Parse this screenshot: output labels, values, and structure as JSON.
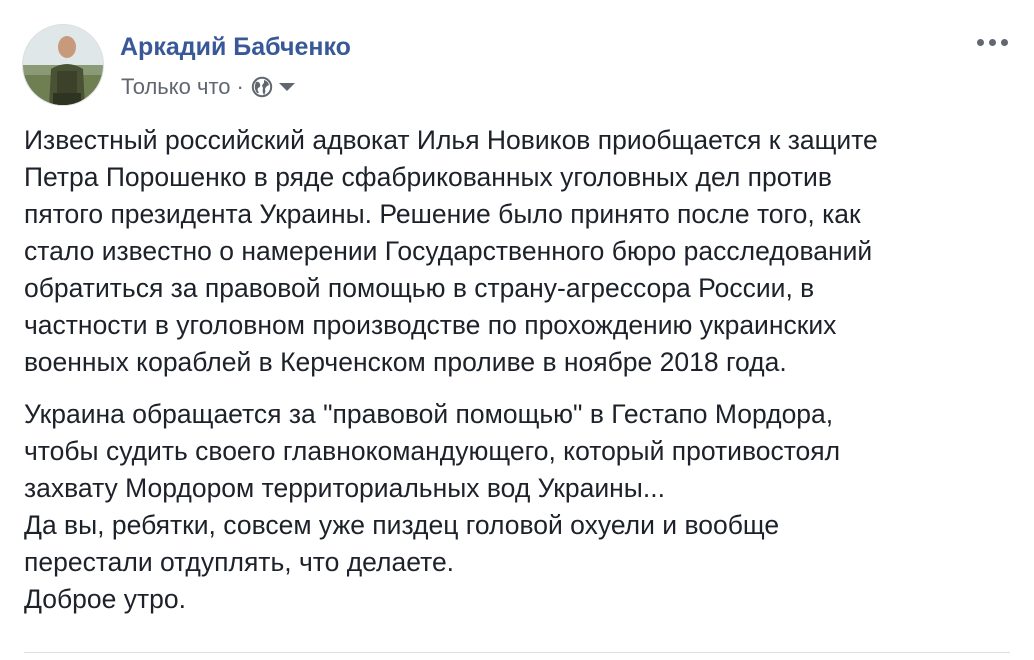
{
  "post": {
    "author_name": "Аркадий Бабченко",
    "timestamp": "Только что",
    "separator": "·",
    "privacy_icon": "globe-icon",
    "audience_menu_icon": "caret-down-icon",
    "more_icon": "more-options-icon",
    "paragraphs": [
      "Известный российский адвокат Илья Новиков приобщается к защите\nПетра Порошенко в ряде сфабрикованных уголовных дел против\nпятого президента Украины. Решение было принято после того, как\nстало известно о намерении Государственного бюро расследований\nобратиться за правовой помощью в страну-агрессора России, в\nчастности в уголовном производстве по прохождению украинских\nвоенных кораблей в Керченском проливе в ноябре 2018 года.",
      "Украина обращается за \"правовой помощью\" в Гестапо Мордора,\nчтобы судить своего главнокомандующего, который противостоял\nзахвату Мордором территориальных вод Украины...\nДа вы, ребятки, совсем уже пиздец головой охуели и вообще\nперестали отдуплять, что делаете.\nДоброе утро."
    ]
  },
  "colors": {
    "author_link": "#385898",
    "meta_text": "#616770",
    "body_text": "#1d2129",
    "divider": "#dddfe2"
  }
}
